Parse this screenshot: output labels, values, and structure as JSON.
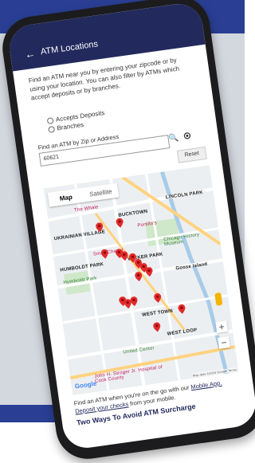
{
  "app": {
    "title": "ATM Locations",
    "back_icon": "arrow-left-icon"
  },
  "intro_text": "Find an ATM near you by entering your zipcode or by using your location. You can also filter by ATMs which accept deposits or by branches.",
  "filters": [
    {
      "label": "Accepts Deposits",
      "selected": false
    },
    {
      "label": "Branches",
      "selected": false
    }
  ],
  "search": {
    "label": "Find an ATM by Zip or Address",
    "value": "60621",
    "search_icon": "search-icon",
    "locate_icon": "crosshair-icon",
    "reset_label": "Reset"
  },
  "map": {
    "tab_map": "Map",
    "tab_satellite": "Satellite",
    "labels": {
      "the_whale": "The Whale",
      "bucktown": "BUCKTOWN",
      "lincoln_park": "LINCOLN PARK",
      "ukrainian_village": "UKRAINIAN VILLAGE",
      "humboldt_park": "HUMBOLDT PARK",
      "small_cheval": "Small Cheval",
      "wicker_park": "WICKER PARK",
      "chicago_history": "Chicago History Museum",
      "humboldt_pk": "Humboldt Park",
      "west_town": "WEST TOWN",
      "west_loop": "WEST LOOP",
      "united_center": "United Center",
      "goose_island": "Goose Island",
      "stroger": "John H. Stroger Jr. Hospital of Cook County",
      "portillos": "Portillo's"
    },
    "zoom_in": "+",
    "zoom_out": "−",
    "google": "Google",
    "footer": "Map data ©2024 Google  Terms",
    "pin_color": "#e02b2b"
  },
  "footer": {
    "text_before_link": "Find an ATM when you're on the go with our ",
    "mobile_link": "Mobile App.",
    "deposit_link": "Deposit your checks",
    "text_after_link": " from your mobile.",
    "heading": "Two Ways To Avoid ATM Surcharge"
  },
  "colors": {
    "navy": "#222a5d",
    "brand_blue": "#2a3f94",
    "pin_red": "#e02b2b"
  }
}
